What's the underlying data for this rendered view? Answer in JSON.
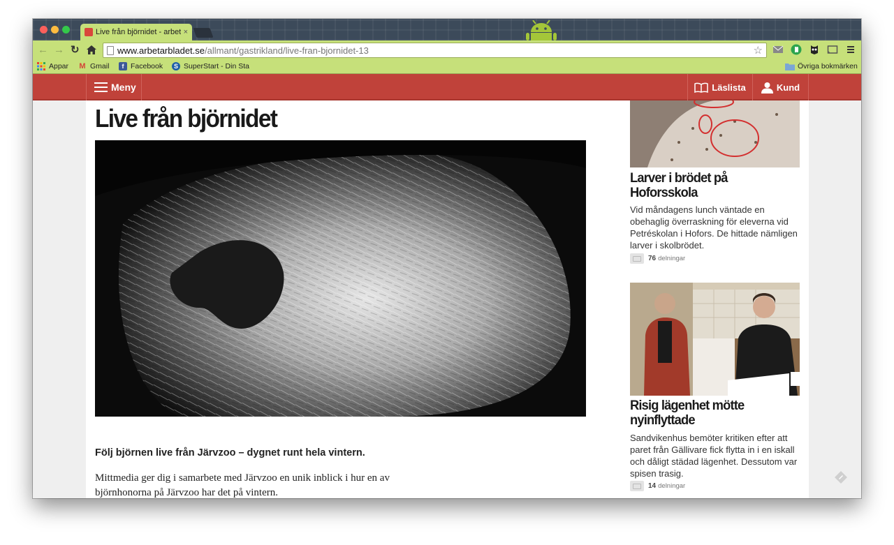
{
  "browser": {
    "tab_title": "Live från björnidet - arbetarbladet.se",
    "tab_close": "×",
    "url_host": "www.arbetarbladet.se",
    "url_path": "/allmant/gastrikland/live-fran-bjornidet-13",
    "bookmarks": [
      {
        "label": "Appar",
        "icon": "apps-grid-icon"
      },
      {
        "label": "Gmail",
        "icon": "gmail-icon"
      },
      {
        "label": "Facebook",
        "icon": "facebook-icon"
      },
      {
        "label": "SuperStart - Din Sta",
        "icon": "superstart-icon"
      }
    ],
    "other_bookmarks": "Övriga bokmärken"
  },
  "sitenav": {
    "menu_label": "Meny",
    "laslista_label": "Läslista",
    "kund_label": "Kund",
    "accent": "#c0423a"
  },
  "article": {
    "title": "Live från björnidet",
    "lede": "Följ björnen live från Järvzoo – dygnet runt hela vintern.",
    "body": "Mittmedia ger dig i samarbete med Järvzoo en unik inblick i hur en av björnhonorna på Järvzoo har det på vintern."
  },
  "sidebar": {
    "items": [
      {
        "title": "Larver i brödet på Hoforsskola",
        "text": "Vid måndagens lunch väntade en obehaglig överraskning för eleverna vid Petréskolan i Hofors. De hittade nämligen larver i skolbrödet.",
        "shares_count": "76",
        "shares_label": "delningar"
      },
      {
        "title": "Risig lägenhet mötte nyinflyttade",
        "text": "Sandvikenhus bemöter kritiken efter att paret från Gällivare fick flytta in i en iskall och dåligt städad lägenhet. Dessutom var spisen trasig.",
        "shares_count": "14",
        "shares_label": "delningar"
      }
    ]
  }
}
